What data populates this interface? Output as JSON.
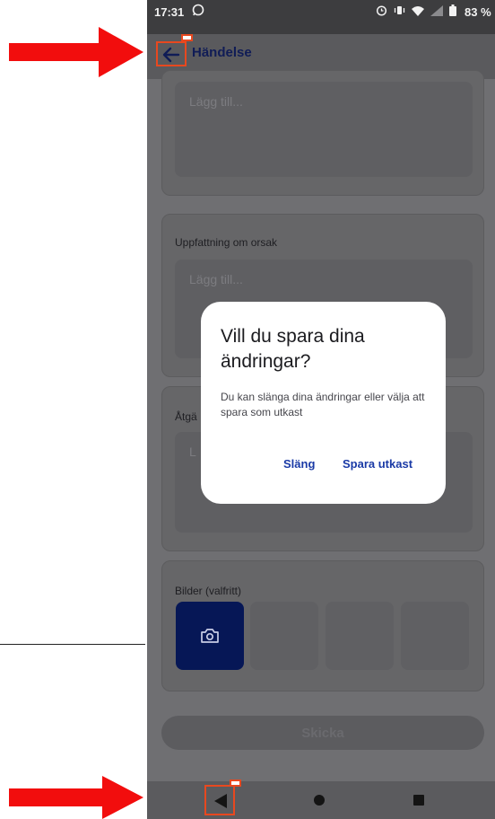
{
  "status_bar": {
    "time": "17:31",
    "battery": "83 %"
  },
  "header": {
    "title": "Händelse"
  },
  "form": {
    "cards": [
      {
        "label": "",
        "placeholder": "Lägg till..."
      },
      {
        "label": "Uppfattning om orsak",
        "placeholder": "Lägg till..."
      },
      {
        "label": "Åtgä",
        "placeholder": "L"
      }
    ],
    "images_label": "Bilder (valfritt)",
    "send_label": "Skicka"
  },
  "dialog": {
    "title": "Vill du spara dina ändringar?",
    "message": "Du kan slänga dina ändringar eller välja att spara som utkast",
    "discard_label": "Släng",
    "save_draft_label": "Spara utkast"
  },
  "colors": {
    "annotation_red": "#e8481f",
    "primary_dark": "#101c56",
    "dialog_action": "#1a3aa6",
    "camera_tile": "#061756"
  },
  "icons": {
    "back": "arrow-left-icon",
    "camera": "camera-icon",
    "nav_back": "triangle-back-icon",
    "nav_home": "circle-home-icon",
    "nav_recent": "square-recent-icon"
  }
}
